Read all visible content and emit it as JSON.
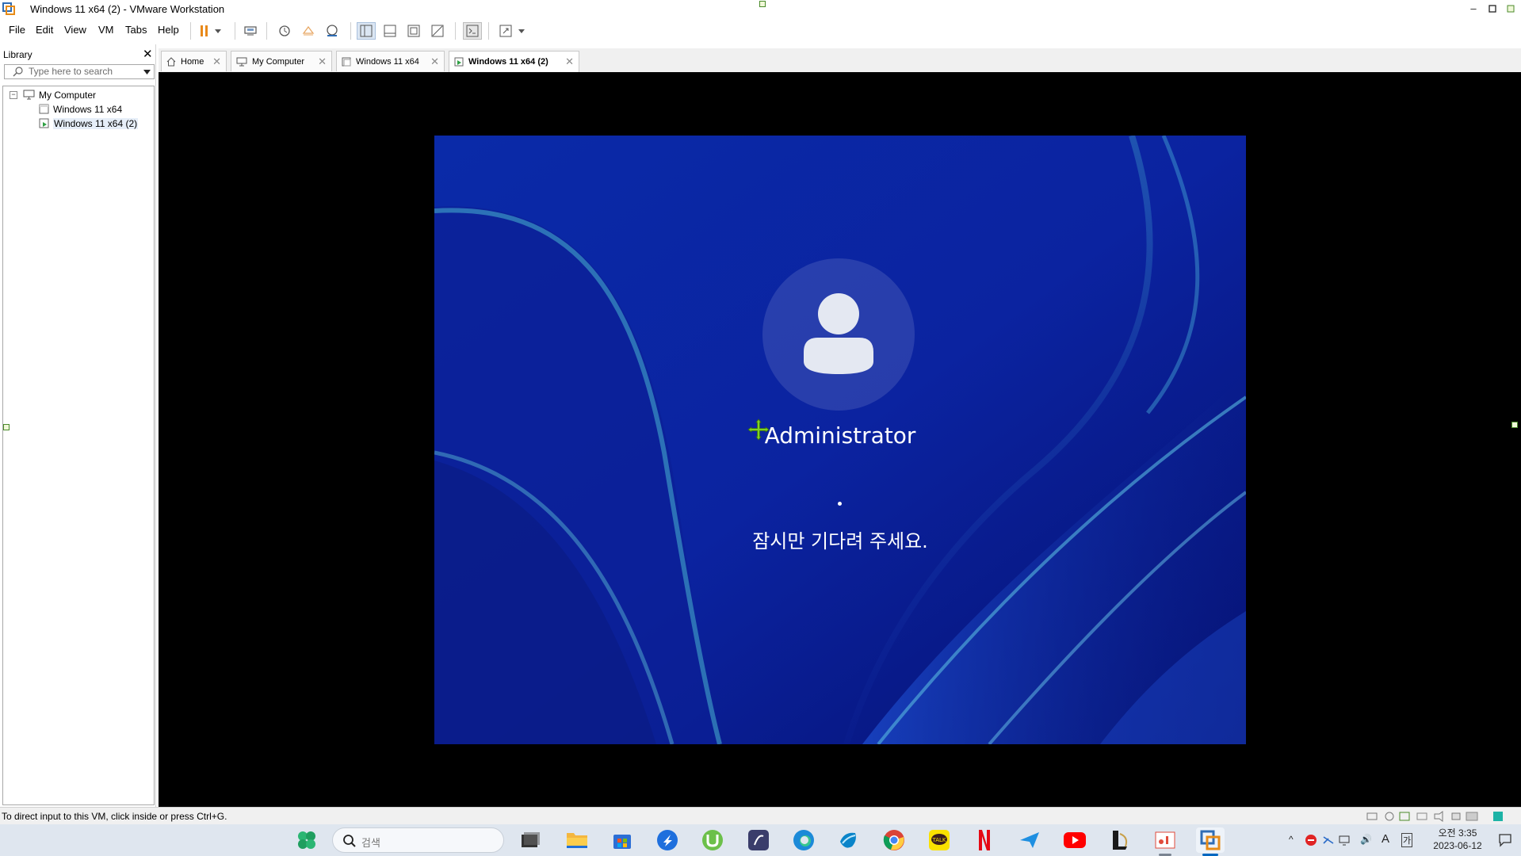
{
  "window": {
    "title": "Windows 11 x64 (2) - VMware Workstation",
    "minimize": "–",
    "maximize": "▫",
    "close": "▫"
  },
  "menu": {
    "items": [
      "File",
      "Edit",
      "View",
      "VM",
      "Tabs",
      "Help"
    ]
  },
  "library": {
    "title": "Library",
    "close": "✕",
    "search_placeholder": "Type here to search",
    "tree": {
      "root": "My Computer",
      "expander": "−",
      "children": [
        "Windows 11 x64",
        "Windows 11 x64 (2)"
      ]
    }
  },
  "tabs": [
    {
      "label": "Home",
      "icon": "home-icon",
      "close": "✕"
    },
    {
      "label": "My Computer",
      "icon": "computer-icon",
      "close": "✕"
    },
    {
      "label": "Windows 11 x64",
      "icon": "vm-icon",
      "close": "✕"
    },
    {
      "label": "Windows 11 x64 (2)",
      "icon": "vm-running-icon",
      "close": "✕"
    }
  ],
  "vm_screen": {
    "username": "Administrator",
    "status": "잠시만 기다려 주세요."
  },
  "statusbar": {
    "message": "To direct input to this VM, click inside or press Ctrl+G."
  },
  "taskbar": {
    "search_placeholder": "검색",
    "apps": [
      "widgets-icon",
      "task-view-icon",
      "file-explorer-icon",
      "store-icon",
      "app-icon",
      "utorrent-icon",
      "app-icon",
      "edge-icon",
      "steam-icon",
      "chrome-icon",
      "kakaotalk-icon",
      "netflix-icon",
      "app-icon",
      "youtube-icon",
      "league-icon",
      "app-icon",
      "vmware-icon"
    ],
    "tray": {
      "chevron": "^",
      "ime": "A",
      "ime2": "가",
      "volume": "🔊"
    },
    "clock": {
      "time": "오전 3:35",
      "date": "2023-06-12"
    }
  },
  "colors": {
    "accent": "#0067c0",
    "vm_bg": "#000000",
    "wallpaper_dark": "#06157a",
    "wallpaper_light": "#2c5ad4"
  }
}
